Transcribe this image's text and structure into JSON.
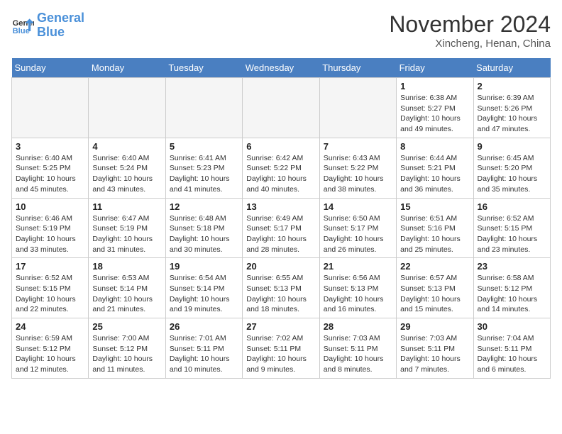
{
  "header": {
    "logo_line1": "General",
    "logo_line2": "Blue",
    "month": "November 2024",
    "location": "Xincheng, Henan, China"
  },
  "weekdays": [
    "Sunday",
    "Monday",
    "Tuesday",
    "Wednesday",
    "Thursday",
    "Friday",
    "Saturday"
  ],
  "weeks": [
    [
      {
        "day": "",
        "info": ""
      },
      {
        "day": "",
        "info": ""
      },
      {
        "day": "",
        "info": ""
      },
      {
        "day": "",
        "info": ""
      },
      {
        "day": "",
        "info": ""
      },
      {
        "day": "1",
        "info": "Sunrise: 6:38 AM\nSunset: 5:27 PM\nDaylight: 10 hours and 49 minutes."
      },
      {
        "day": "2",
        "info": "Sunrise: 6:39 AM\nSunset: 5:26 PM\nDaylight: 10 hours and 47 minutes."
      }
    ],
    [
      {
        "day": "3",
        "info": "Sunrise: 6:40 AM\nSunset: 5:25 PM\nDaylight: 10 hours and 45 minutes."
      },
      {
        "day": "4",
        "info": "Sunrise: 6:40 AM\nSunset: 5:24 PM\nDaylight: 10 hours and 43 minutes."
      },
      {
        "day": "5",
        "info": "Sunrise: 6:41 AM\nSunset: 5:23 PM\nDaylight: 10 hours and 41 minutes."
      },
      {
        "day": "6",
        "info": "Sunrise: 6:42 AM\nSunset: 5:22 PM\nDaylight: 10 hours and 40 minutes."
      },
      {
        "day": "7",
        "info": "Sunrise: 6:43 AM\nSunset: 5:22 PM\nDaylight: 10 hours and 38 minutes."
      },
      {
        "day": "8",
        "info": "Sunrise: 6:44 AM\nSunset: 5:21 PM\nDaylight: 10 hours and 36 minutes."
      },
      {
        "day": "9",
        "info": "Sunrise: 6:45 AM\nSunset: 5:20 PM\nDaylight: 10 hours and 35 minutes."
      }
    ],
    [
      {
        "day": "10",
        "info": "Sunrise: 6:46 AM\nSunset: 5:19 PM\nDaylight: 10 hours and 33 minutes."
      },
      {
        "day": "11",
        "info": "Sunrise: 6:47 AM\nSunset: 5:19 PM\nDaylight: 10 hours and 31 minutes."
      },
      {
        "day": "12",
        "info": "Sunrise: 6:48 AM\nSunset: 5:18 PM\nDaylight: 10 hours and 30 minutes."
      },
      {
        "day": "13",
        "info": "Sunrise: 6:49 AM\nSunset: 5:17 PM\nDaylight: 10 hours and 28 minutes."
      },
      {
        "day": "14",
        "info": "Sunrise: 6:50 AM\nSunset: 5:17 PM\nDaylight: 10 hours and 26 minutes."
      },
      {
        "day": "15",
        "info": "Sunrise: 6:51 AM\nSunset: 5:16 PM\nDaylight: 10 hours and 25 minutes."
      },
      {
        "day": "16",
        "info": "Sunrise: 6:52 AM\nSunset: 5:15 PM\nDaylight: 10 hours and 23 minutes."
      }
    ],
    [
      {
        "day": "17",
        "info": "Sunrise: 6:52 AM\nSunset: 5:15 PM\nDaylight: 10 hours and 22 minutes."
      },
      {
        "day": "18",
        "info": "Sunrise: 6:53 AM\nSunset: 5:14 PM\nDaylight: 10 hours and 21 minutes."
      },
      {
        "day": "19",
        "info": "Sunrise: 6:54 AM\nSunset: 5:14 PM\nDaylight: 10 hours and 19 minutes."
      },
      {
        "day": "20",
        "info": "Sunrise: 6:55 AM\nSunset: 5:13 PM\nDaylight: 10 hours and 18 minutes."
      },
      {
        "day": "21",
        "info": "Sunrise: 6:56 AM\nSunset: 5:13 PM\nDaylight: 10 hours and 16 minutes."
      },
      {
        "day": "22",
        "info": "Sunrise: 6:57 AM\nSunset: 5:13 PM\nDaylight: 10 hours and 15 minutes."
      },
      {
        "day": "23",
        "info": "Sunrise: 6:58 AM\nSunset: 5:12 PM\nDaylight: 10 hours and 14 minutes."
      }
    ],
    [
      {
        "day": "24",
        "info": "Sunrise: 6:59 AM\nSunset: 5:12 PM\nDaylight: 10 hours and 12 minutes."
      },
      {
        "day": "25",
        "info": "Sunrise: 7:00 AM\nSunset: 5:12 PM\nDaylight: 10 hours and 11 minutes."
      },
      {
        "day": "26",
        "info": "Sunrise: 7:01 AM\nSunset: 5:11 PM\nDaylight: 10 hours and 10 minutes."
      },
      {
        "day": "27",
        "info": "Sunrise: 7:02 AM\nSunset: 5:11 PM\nDaylight: 10 hours and 9 minutes."
      },
      {
        "day": "28",
        "info": "Sunrise: 7:03 AM\nSunset: 5:11 PM\nDaylight: 10 hours and 8 minutes."
      },
      {
        "day": "29",
        "info": "Sunrise: 7:03 AM\nSunset: 5:11 PM\nDaylight: 10 hours and 7 minutes."
      },
      {
        "day": "30",
        "info": "Sunrise: 7:04 AM\nSunset: 5:11 PM\nDaylight: 10 hours and 6 minutes."
      }
    ]
  ]
}
